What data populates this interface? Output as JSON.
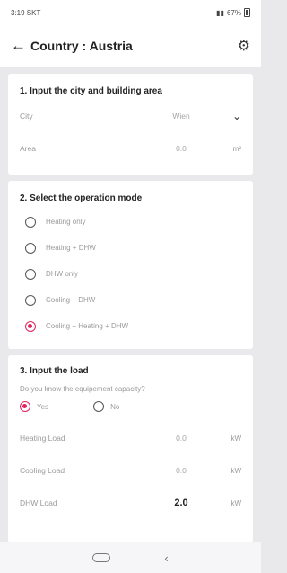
{
  "status_bar": {
    "time": "3:19 SKT",
    "right": "67%"
  },
  "app_bar": {
    "title": "Country : Austria",
    "back_icon": "arrow-left-icon",
    "settings_icon": "gear-icon"
  },
  "section1": {
    "title": "1. Input the city and building area",
    "city_label": "City",
    "city_value": "Wien",
    "area_label": "Area",
    "area_value": "0.0",
    "area_unit": "m²"
  },
  "section2": {
    "title": "2. Select the operation mode",
    "options": [
      {
        "label": "Heating only",
        "selected": false
      },
      {
        "label": "Heating + DHW",
        "selected": false
      },
      {
        "label": "DHW only",
        "selected": false
      },
      {
        "label": "Cooling + DHW",
        "selected": false
      },
      {
        "label": "Cooling + Heating + DHW",
        "selected": true
      }
    ]
  },
  "section3": {
    "title": "3. Input the load",
    "question": "Do you know the equipement capacity?",
    "yes_label": "Yes",
    "no_label": "No",
    "yes_selected": true,
    "heating_label": "Heating Load",
    "heating_value": "0.0",
    "heating_unit": "kW",
    "cooling_label": "Cooling Load",
    "cooling_value": "0.0",
    "cooling_unit": "kW",
    "dhw_label": "DHW Load",
    "dhw_value": "2.0",
    "dhw_unit": "kW"
  },
  "colors": {
    "accent": "#e0245e",
    "background": "#e9e9ec"
  }
}
